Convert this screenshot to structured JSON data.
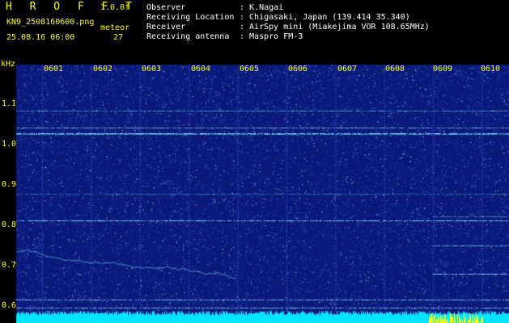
{
  "header": {
    "app_name": "H R O F F T",
    "version": "1.0.0f",
    "filename": "KN9_2508160600.png",
    "datetime": "25.08.16 06:00",
    "meteor_label": "meteor",
    "meteor_count": "27",
    "info": [
      {
        "key": "Observer",
        "value": ": K.Nagai"
      },
      {
        "key": "Receiving Location",
        "value": ": Chigasaki, Japan (139.414 35.340)"
      },
      {
        "key": "Receiver",
        "value": ": AirSpy mini (Miakejima VOR 108.65MHz)"
      },
      {
        "key": "Receiving antenna",
        "value": ": Maspro FM-3"
      }
    ]
  },
  "axis": {
    "unit": "kHz",
    "y_ticks": [
      "1.1",
      "1.0",
      "0.9",
      "0.8",
      "0.7",
      "0.6"
    ],
    "hour_labels": [
      "0601",
      "0602",
      "0603",
      "0604",
      "0605",
      "0606",
      "0607",
      "0608",
      "0609",
      "0610"
    ]
  },
  "colors": {
    "background": "#000000",
    "spectrum": "#0b1a7a",
    "noise": "#4a7fff",
    "line": "#7fe0ff",
    "text": "#ffff00",
    "bottom_band": "#00e5ff"
  }
}
